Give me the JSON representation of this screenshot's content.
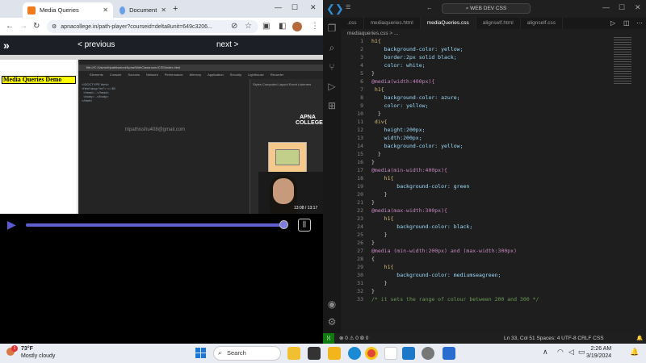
{
  "chrome": {
    "tabs": [
      {
        "label": "Media Queries",
        "icon": "apna-college-favicon"
      },
      {
        "label": "Document",
        "icon": "globe-favicon"
      }
    ],
    "url": "apnacollege.in/path-player?courseid=delta8unit=649c3206..."
  },
  "player": {
    "prev_label": "< previous",
    "next_label": "next >",
    "timestamp": "13:08 / 13:17"
  },
  "video": {
    "demo_heading": "Media Queries Demo",
    "devtools_url": "file:///C:/Users/tripathisaloni/Apna/WebClassroom/CSS/index.html",
    "devtools_tabs": [
      "Elements",
      "Console",
      "Sources",
      "Network",
      "Performance",
      "Memory",
      "Application",
      "Security",
      "Lighthouse",
      "Recorder"
    ],
    "styles_tabs": "Styles  Computed  Layout  Event Listeners",
    "watermark_email": "tripathisshu408@gmail.com",
    "logo": "APNA COLLEGE",
    "dom_lines": [
      "<!DOCTYPE html>",
      "<html lang=\"en\"> == $0",
      "  <head>...</head>",
      "  <body>...</body>",
      "</html>"
    ]
  },
  "vscode": {
    "search": "WEB DEV CSS",
    "tabs": [
      ".css",
      "mediaqueries.html",
      "mediaQueries.css",
      "alignself.html",
      "alignself.css"
    ],
    "active_tab": 2,
    "breadcrumb": "mediaqueries.css > ...",
    "code_lines": [
      {
        "n": "1",
        "t": "h1{"
      },
      {
        "n": "2",
        "t": "    background-color: yellow;"
      },
      {
        "n": "3",
        "t": "    border:2px solid black;"
      },
      {
        "n": "4",
        "t": "    color: white;"
      },
      {
        "n": "5",
        "t": "}"
      },
      {
        "n": "6",
        "t": "@media(width:400px){"
      },
      {
        "n": "7",
        "t": " h1{"
      },
      {
        "n": "8",
        "t": "    background-color: azure;"
      },
      {
        "n": "9",
        "t": "    color: yellow;"
      },
      {
        "n": "10",
        "t": "  }"
      },
      {
        "n": "11",
        "t": " div{"
      },
      {
        "n": "12",
        "t": "    height:200px;"
      },
      {
        "n": "13",
        "t": "    width:200px;"
      },
      {
        "n": "14",
        "t": "    background-color: yellow;"
      },
      {
        "n": "15",
        "t": "  }"
      },
      {
        "n": "16",
        "t": "}"
      },
      {
        "n": "17",
        "t": "@media(min-width:400px){"
      },
      {
        "n": "18",
        "t": "    h1{"
      },
      {
        "n": "19",
        "t": "        background-color: green"
      },
      {
        "n": "20",
        "t": "    }"
      },
      {
        "n": "21",
        "t": "}"
      },
      {
        "n": "22",
        "t": "@media(max-width:300px){"
      },
      {
        "n": "23",
        "t": "    h1{"
      },
      {
        "n": "24",
        "t": "        background-color: black;"
      },
      {
        "n": "25",
        "t": "    }"
      },
      {
        "n": "26",
        "t": "}"
      },
      {
        "n": "27",
        "t": "@media (min-width:200px) and (max-width:300px)"
      },
      {
        "n": "28",
        "t": "{"
      },
      {
        "n": "29",
        "t": "    h1{"
      },
      {
        "n": "30",
        "t": "        background-color: mediumseagreen;"
      },
      {
        "n": "31",
        "t": "    }"
      },
      {
        "n": "32",
        "t": "}"
      },
      {
        "n": "33",
        "t": "/* it sets the range of colour between 200 and 300 */"
      }
    ],
    "status_left": "⊗ 0  ⚠ 0  ⦾ 0",
    "status_right": "Ln 33, Col 51   Spaces: 4   UTF-8   CRLF   CSS"
  },
  "taskbar": {
    "weather_temp": "73°F",
    "weather_desc": "Mostly cloudy",
    "search_label": "Search",
    "time": "2:26 AM",
    "date": "3/19/2024",
    "notification_count": "1"
  },
  "colors": {
    "accent": "#5f5fd0",
    "vscode_bg": "#1e1e1e",
    "status_green": "#0e7a0d"
  }
}
